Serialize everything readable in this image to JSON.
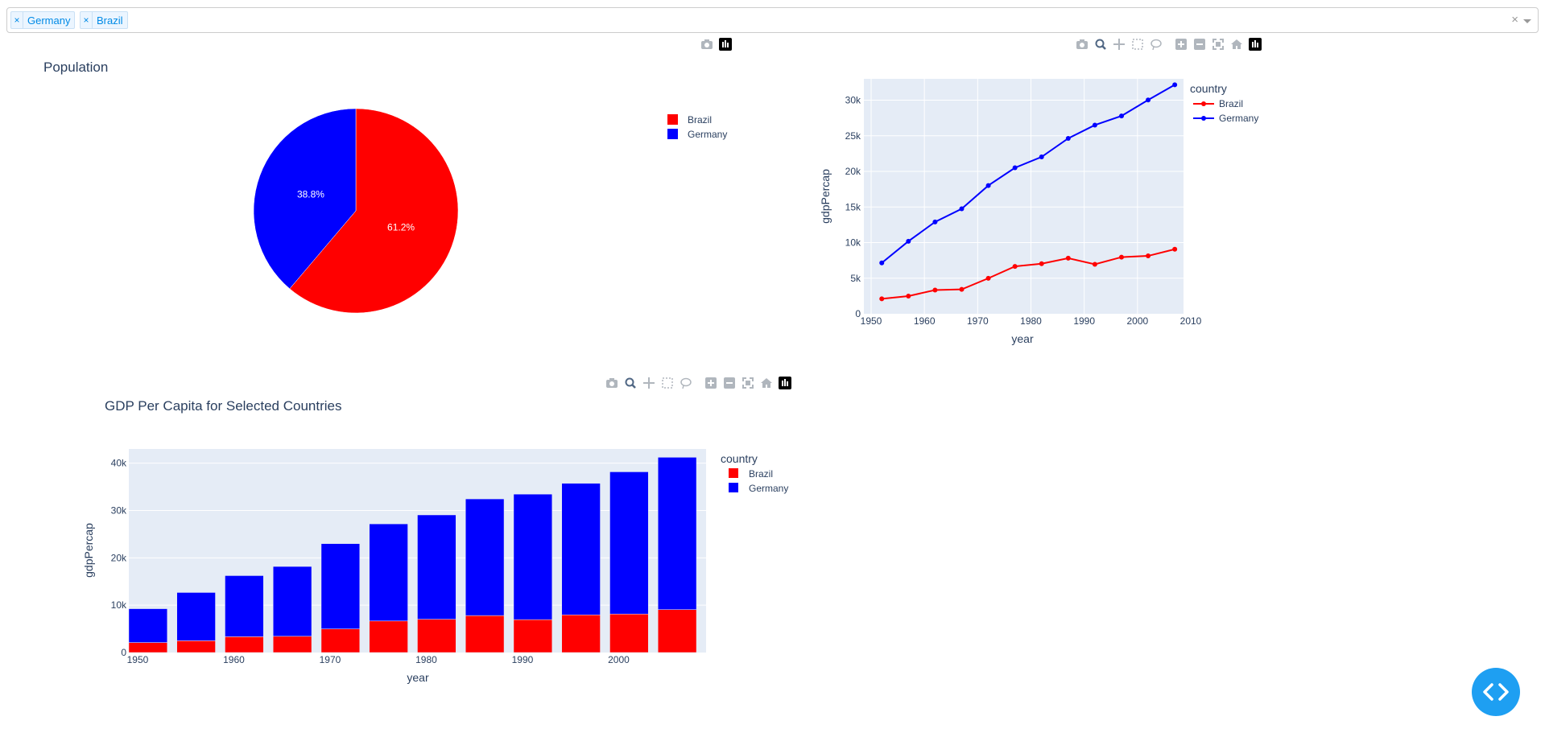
{
  "dropdown": {
    "tags": [
      {
        "label": "Germany"
      },
      {
        "label": "Brazil"
      }
    ],
    "remove_symbol": "×",
    "clear_symbol": "×"
  },
  "colors": {
    "brazil": "#ff0000",
    "germany": "#0000ff",
    "plot_bg": "#e5ecf6",
    "text": "#2a3f5f"
  },
  "pie": {
    "title": "Population",
    "legend": [
      "Brazil",
      "Germany"
    ],
    "slices": [
      {
        "label": "Brazil",
        "percent": 61.2,
        "color": "#ff0000",
        "text": "61.2%"
      },
      {
        "label": "Germany",
        "percent": 38.8,
        "color": "#0000ff",
        "text": "38.8%"
      }
    ]
  },
  "line_chart": {
    "legend_title": "country",
    "xlabel": "year",
    "ylabel": "gdpPercap",
    "x_ticks": [
      "1950",
      "1960",
      "1970",
      "1980",
      "1990",
      "2000",
      "2010"
    ],
    "y_ticks": [
      "0",
      "5k",
      "10k",
      "15k",
      "20k",
      "25k",
      "30k"
    ]
  },
  "bar_chart": {
    "title": "GDP Per Capita for Selected Countries",
    "legend_title": "country",
    "xlabel": "year",
    "ylabel": "gdpPercap",
    "x_ticks": [
      "1950",
      "1960",
      "1970",
      "1980",
      "1990",
      "2000"
    ],
    "y_ticks": [
      "0",
      "10k",
      "20k",
      "30k",
      "40k"
    ]
  },
  "chart_data": [
    {
      "type": "pie",
      "title": "Population",
      "labels": [
        "Brazil",
        "Germany"
      ],
      "values": [
        61.2,
        38.8
      ],
      "colors": [
        "#ff0000",
        "#0000ff"
      ],
      "legend": "top-right"
    },
    {
      "type": "line",
      "title": "",
      "xlabel": "year",
      "ylabel": "gdpPercap",
      "x": [
        1952,
        1957,
        1962,
        1967,
        1972,
        1977,
        1982,
        1987,
        1992,
        1997,
        2002,
        2007
      ],
      "xlim": [
        1950,
        2010
      ],
      "ylim": [
        0,
        33000
      ],
      "grid": true,
      "legend": "top-right",
      "legend_title": "country",
      "series": [
        {
          "name": "Brazil",
          "color": "#ff0000",
          "values": [
            2108,
            2487,
            3337,
            3430,
            4986,
            6660,
            7031,
            7807,
            6950,
            7958,
            8131,
            9066
          ]
        },
        {
          "name": "Germany",
          "color": "#0000ff",
          "values": [
            7144,
            10188,
            12902,
            14746,
            18016,
            20513,
            22032,
            24639,
            26505,
            27789,
            30036,
            32170
          ]
        }
      ]
    },
    {
      "type": "bar",
      "title": "GDP Per Capita for Selected Countries",
      "xlabel": "year",
      "ylabel": "gdpPercap",
      "stacked": true,
      "x": [
        1952,
        1957,
        1962,
        1967,
        1972,
        1977,
        1982,
        1987,
        1992,
        1997,
        2002,
        2007
      ],
      "xlim": [
        1949.5,
        2009.5
      ],
      "ylim": [
        0,
        43000
      ],
      "grid": true,
      "legend": "top-right",
      "legend_title": "country",
      "series": [
        {
          "name": "Brazil",
          "color": "#ff0000",
          "values": [
            2108,
            2487,
            3337,
            3430,
            4986,
            6660,
            7031,
            7807,
            6950,
            7958,
            8131,
            9066
          ]
        },
        {
          "name": "Germany",
          "color": "#0000ff",
          "values": [
            7144,
            10188,
            12902,
            14746,
            18016,
            20513,
            22032,
            24639,
            26505,
            27789,
            30036,
            32170
          ]
        }
      ]
    }
  ]
}
